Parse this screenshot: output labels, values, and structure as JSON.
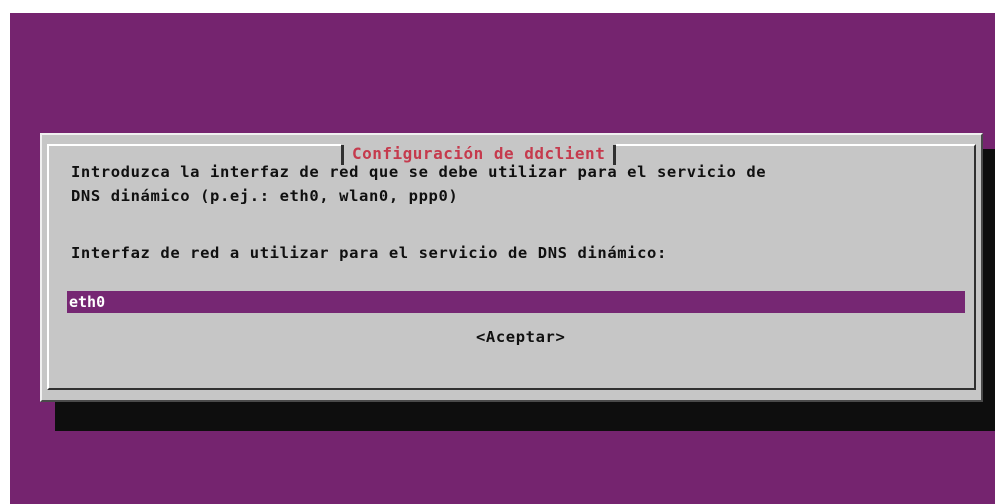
{
  "dialog": {
    "title": "Configuración de ddclient",
    "description_line1": "Introduzca la interfaz de red que se debe utilizar para el servicio de",
    "description_line2": "DNS dinámico (p.ej.: eth0, wlan0, ppp0)",
    "prompt": "Interfaz de red a utilizar para el servicio de DNS dinámico:",
    "input_value": "eth0",
    "ok_label": "<Aceptar>"
  },
  "colors": {
    "background": "#75246f",
    "dialog": "#c6c6c6",
    "title": "#c53a4d",
    "input_highlight": "#762773",
    "shadow": "#0e0e0e"
  }
}
